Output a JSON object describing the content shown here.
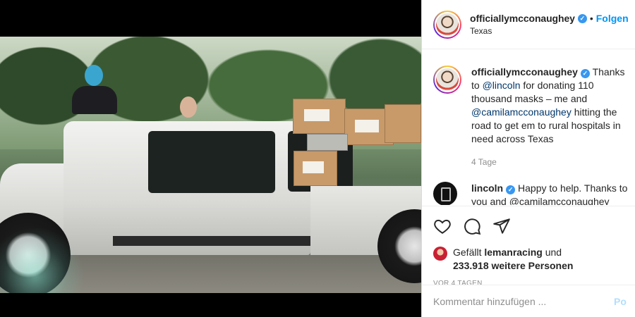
{
  "post": {
    "username": "officiallymcconaughey",
    "follow_label": "Folgen",
    "location": "Texas",
    "separator": "•"
  },
  "caption": {
    "username": "officiallymcconaughey",
    "text_part1": " Thanks to ",
    "mention1": "@lincoln",
    "text_part2": " for donating 110 thousand masks – me and ",
    "mention2": "@camilamcconaughey",
    "text_part3": " hitting the road to get em to rural hospitals in need across Texas",
    "time": "4 Tage"
  },
  "comments": [
    {
      "username": "lincoln",
      "text": " Happy to help. Thanks to you and @camilamcconaughey"
    }
  ],
  "actions": {
    "icons": [
      "heart-icon",
      "comment-icon",
      "share-icon"
    ]
  },
  "likes": {
    "prefix": "Gefällt ",
    "liker": "lemanracing",
    "middle": " und",
    "count": "233.918 weitere Personen"
  },
  "date": "VOR 4 TAGEN",
  "comment_input": {
    "placeholder": "Kommentar hinzufügen ...",
    "post_label": "Po"
  },
  "colors": {
    "accent": "#0095f6",
    "verified": "#3897f0",
    "text": "#262626",
    "muted": "#8e8e8e"
  }
}
